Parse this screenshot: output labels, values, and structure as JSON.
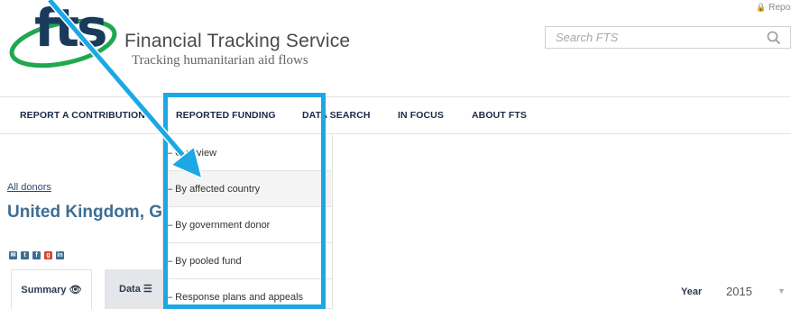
{
  "brand": {
    "logo_text": "fts",
    "name": "Financial Tracking Service",
    "tagline": "Tracking humanitarian aid flows"
  },
  "header": {
    "report_link": "Report",
    "search_placeholder": "Search FTS"
  },
  "nav": {
    "items": [
      "REPORT A CONTRIBUTION",
      "REPORTED FUNDING",
      "DATA SEARCH",
      "IN FOCUS",
      "ABOUT FTS"
    ]
  },
  "dropdown": {
    "items": [
      "– Overview",
      "– By affected country",
      "– By government donor",
      "– By pooled fund",
      "– Response plans and appeals"
    ]
  },
  "page": {
    "breadcrumb": "All donors",
    "title": "United Kingdom, G",
    "title_tail": "",
    "share_icons": [
      "email-icon",
      "twitter-icon",
      "facebook-icon",
      "google-plus-icon",
      "linkedin-icon"
    ]
  },
  "tabs": {
    "summary": "Summary",
    "data": "Data"
  },
  "filter": {
    "year_label": "Year",
    "year_value": "2015"
  },
  "colors": {
    "highlight": "#1ba8e4",
    "title": "#3e6e93",
    "nav_text": "#1a2a44"
  }
}
